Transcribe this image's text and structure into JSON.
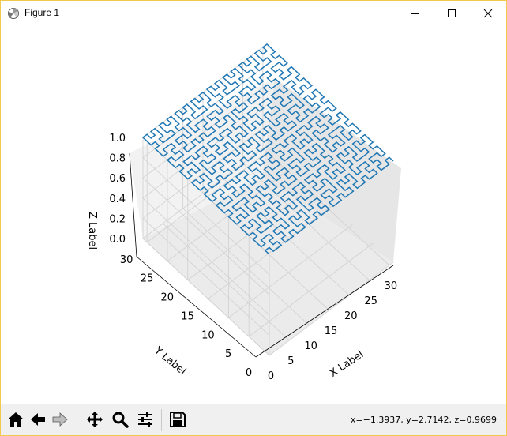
{
  "window": {
    "title": "Figure 1"
  },
  "toolbar": {
    "buttons": [
      {
        "name": "home",
        "icon": "home-icon"
      },
      {
        "name": "back",
        "icon": "arrow-left-icon"
      },
      {
        "name": "forward",
        "icon": "arrow-right-icon"
      },
      {
        "name": "pan",
        "icon": "move-icon"
      },
      {
        "name": "zoom",
        "icon": "magnifier-icon"
      },
      {
        "name": "configure-subplots",
        "icon": "sliders-icon"
      },
      {
        "name": "save",
        "icon": "floppy-disk-icon"
      }
    ],
    "coordinates": "x=−1.3937, y=2.7142, z=0.9699"
  },
  "chart_data": {
    "type": "line3d",
    "series": [
      {
        "description_of_shape": "Hilbert-curve-like space-filling path plotted on plane z=1, ranging across x 0–31 and y 0–31",
        "color": "#1f77b4"
      }
    ],
    "xlabel": "X Label",
    "ylabel": "Y Label",
    "zlabel": "Z Label",
    "xlim": [
      0,
      31
    ],
    "ylim": [
      0,
      31
    ],
    "zlim": [
      0,
      1
    ],
    "x_ticks": [
      "0",
      "5",
      "10",
      "15",
      "20",
      "25",
      "30"
    ],
    "y_ticks": [
      "0",
      "5",
      "10",
      "15",
      "20",
      "25",
      "30"
    ],
    "z_ticks": [
      "0.0",
      "0.2",
      "0.4",
      "0.6",
      "0.8",
      "1.0"
    ],
    "grid": true
  }
}
